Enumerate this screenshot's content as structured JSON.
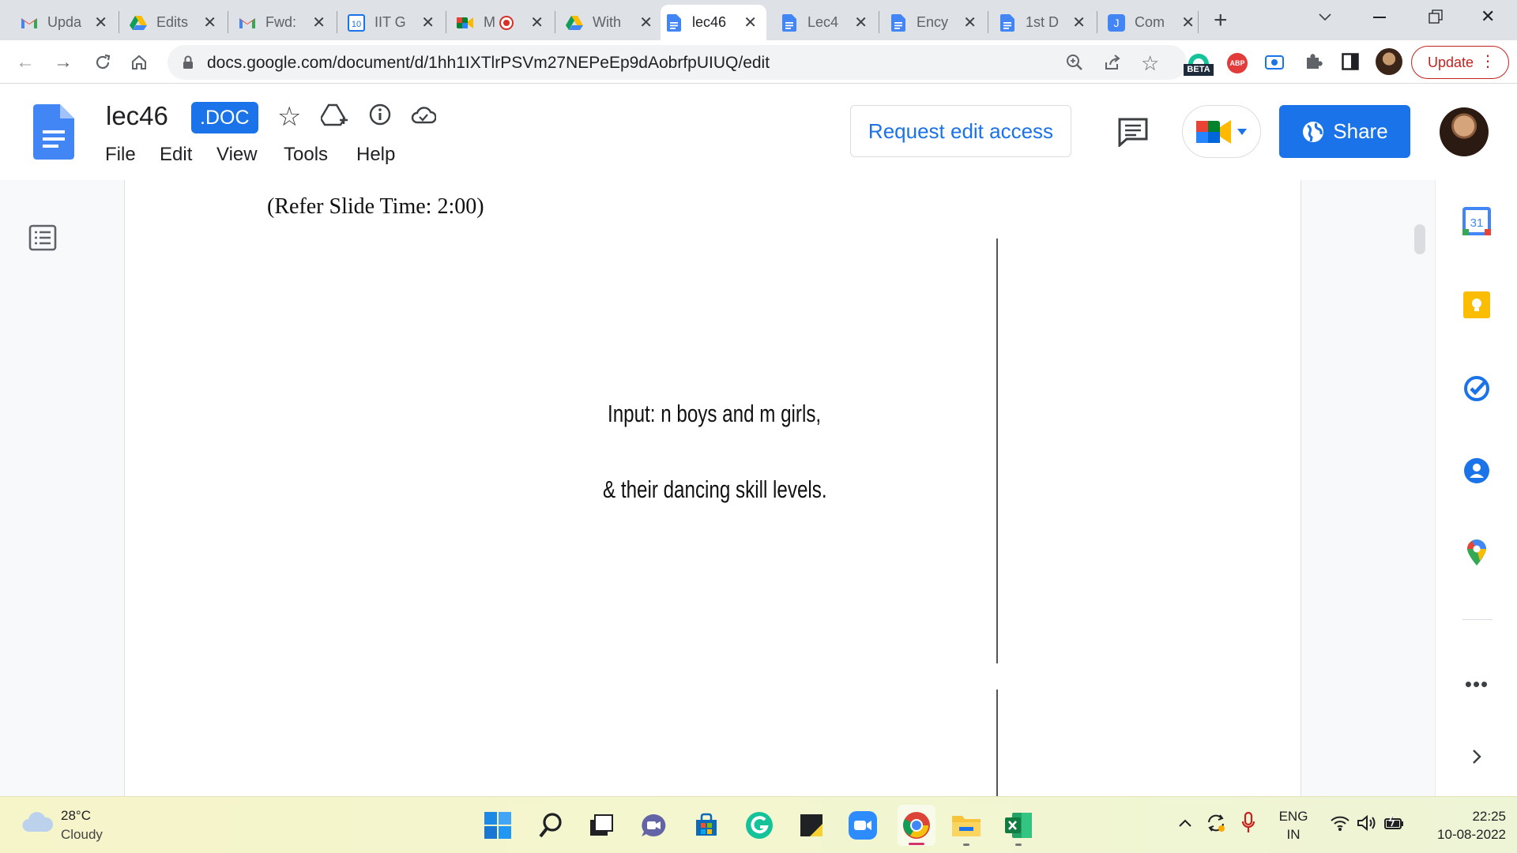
{
  "browser": {
    "tabs": [
      {
        "title": "Upda",
        "icon": "gmail-icon",
        "active": false
      },
      {
        "title": "Edits",
        "icon": "google-drive-icon",
        "active": false
      },
      {
        "title": "Fwd:",
        "icon": "gmail-icon",
        "active": false
      },
      {
        "title": "IIT G",
        "icon": "calendar-10-icon",
        "active": false
      },
      {
        "title": "M",
        "icon": "google-meet-icon",
        "active": false
      },
      {
        "title": "With",
        "icon": "google-drive-icon",
        "active": false
      },
      {
        "title": "lec46",
        "icon": "google-docs-icon",
        "active": true
      },
      {
        "title": "Lec4",
        "icon": "google-docs-icon",
        "active": false
      },
      {
        "title": "Ency",
        "icon": "google-docs-icon",
        "active": false
      },
      {
        "title": "1st D",
        "icon": "google-docs-icon",
        "active": false
      },
      {
        "title": "Com",
        "icon": "j-app-icon",
        "active": false
      }
    ],
    "calendar_tab_number": "10",
    "url": "docs.google.com/document/d/1hh1IXTlrPSVm27NEPeEp9dAobrfpUIUQ/edit",
    "update_label": "Update",
    "extensions": {
      "beta_label": "BETA",
      "abp_label": "ABP"
    }
  },
  "docs": {
    "title": "lec46",
    "format_badge": ".DOC",
    "menu": [
      "File",
      "Edit",
      "View",
      "Tools",
      "Help"
    ],
    "request_edit_label": "Request edit access",
    "share_label": "Share"
  },
  "document": {
    "refer_slide_time": "(Refer Slide Time: 2:00)",
    "slide_line_1": "Input: n boys and m girls,",
    "slide_line_2": "& their dancing skill levels."
  },
  "side_panel": {
    "calendar_day": "31"
  },
  "taskbar": {
    "weather_temp": "28°C",
    "weather_desc": "Cloudy",
    "language": "ENG",
    "region": "IN",
    "time": "22:25",
    "date": "10-08-2022"
  },
  "colors": {
    "accent": "#1a73e8",
    "update_red": "#c5221f",
    "tab_strip": "#dee1e6"
  }
}
